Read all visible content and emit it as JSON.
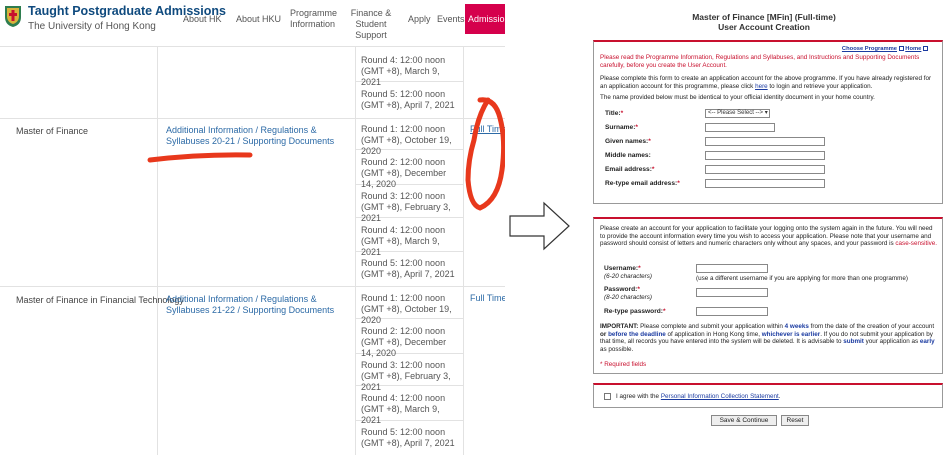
{
  "header": {
    "title": "Taught Postgraduate Admissions",
    "subtitle": "The University of Hong Kong",
    "nav": [
      "About HK",
      "About HKU",
      "Programme Information",
      "Finance & Student Support",
      "Apply",
      "Events",
      "Admissions"
    ]
  },
  "rows": {
    "prev_rounds": [
      "Round 4: 12:00 noon (GMT +8), March 9, 2021",
      "Round 5: 12:00 noon (GMT +8), April 7, 2021"
    ],
    "mfin": {
      "name": "Master of Finance",
      "links": "Additional Information / Regulations & Syllabuses 20-21 / Supporting Documents",
      "mode": "Full Time",
      "rounds": [
        "Round 1: 12:00 noon (GMT +8), October 19, 2020",
        "Round 2: 12:00 noon (GMT +8), December 14, 2020",
        "Round 3: 12:00 noon (GMT +8), February 3, 2021",
        "Round 4: 12:00 noon (GMT +8), March 9, 2021",
        "Round 5: 12:00 noon (GMT +8), April 7, 2021"
      ]
    },
    "mfintech": {
      "name": "Master of Finance in Financial Technology",
      "links": "Additional Information / Regulations & Syllabuses 21-22 / Supporting Documents",
      "mode": "Full Time",
      "rounds": [
        "Round 1: 12:00 noon (GMT +8), October 19, 2020",
        "Round 2: 12:00 noon (GMT +8), December 14, 2020",
        "Round 3: 12:00 noon (GMT +8), February 3, 2021",
        "Round 4: 12:00 noon (GMT +8), March 9, 2021",
        "Round 5: 12:00 noon (GMT +8), April 7, 2021"
      ]
    }
  },
  "form": {
    "title_line1": "Master of Finance [MFin] (Full-time)",
    "title_line2": "User Account Creation",
    "toplinks": {
      "choose": "Choose Programme",
      "home": "Home"
    },
    "warning": "Please read the Programme Information, Regulations and Syllabuses, and Instructions and Supporting Documents carefully, before you create the User Account.",
    "intro_a": "Please complete this form to create an application account for the above programme. If you have already registered for an application account for this programme, please click",
    "intro_here": "here",
    "intro_b": "to login and retrieve your application.",
    "identity_note": "The name provided below must be identical to your official identity document in your home country.",
    "fields": {
      "title": "Title:",
      "title_placeholder": "<-- Please Select --> ▾",
      "surname": "Surname:",
      "given": "Given names:",
      "middle": "Middle names:",
      "email": "Email address:",
      "email2": "Re-type email address:"
    },
    "account_intro": "Please create an account for your application to facilitate your logging onto the system again in the future. You will need to provide the account information every time you wish to access your application. Please note that your username and password should consist of letters and numeric characters only without any spaces, and your password is",
    "case_sensitive": "case-sensitive.",
    "username": "Username:",
    "username_hint": "(6-20 characters)",
    "username_note": "(use a different username if you are applying for more than one programme)",
    "password": "Password:",
    "password_hint": "(8-20 characters)",
    "password2": "Re-type password:",
    "important": {
      "lead": "IMPORTANT:",
      "t1": "Please complete and submit your application within",
      "weeks": "4 weeks",
      "t2": "from the date of the creation of your account",
      "or": "or",
      "before": "before the deadline",
      "t3": "of application in Hong Kong time,",
      "earlier": "whichever is earlier",
      "t4": ". If you do not submit your application by that time, all records you have entered into the system will be deleted. It is advisable to",
      "submit": "submit",
      "t5": "your application as",
      "early": "early",
      "t6": "as possible."
    },
    "required": "* Required fields",
    "agree_pre": "I agree with the",
    "agree_link": "Personal Information Collection Statement",
    "save": "Save & Continue",
    "reset": "Reset"
  },
  "colors": {
    "brand_red": "#c8102e",
    "link_blue": "#2c6aa6",
    "admissions_tab": "#d5004c",
    "annotation": "#e8381c"
  },
  "icons": [
    "hku-crest-icon",
    "right-arrow-icon",
    "external-window-icon"
  ]
}
